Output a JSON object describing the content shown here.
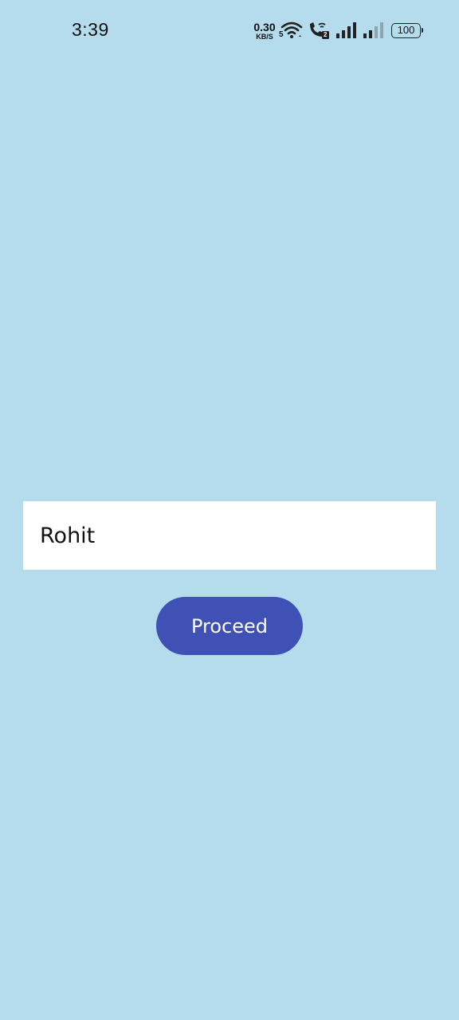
{
  "status_bar": {
    "time": "3:39",
    "net_speed_value": "0.30",
    "net_speed_unit": "KB/S",
    "wifi_badge": "5",
    "call_badge": "2",
    "battery": "100",
    "icons": [
      "wifi-icon",
      "wifi-calling-icon",
      "signal-icon",
      "signal-icon"
    ]
  },
  "form": {
    "name_value": "Rohit",
    "proceed_label": "Proceed"
  },
  "colors": {
    "background": "#b5dced",
    "button": "#3f51b5",
    "field": "#ffffff"
  }
}
